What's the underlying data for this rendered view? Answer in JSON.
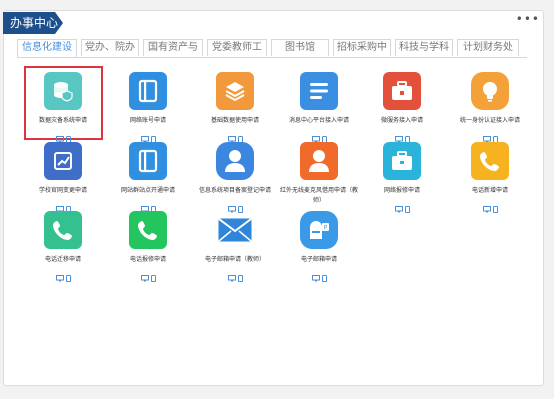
{
  "header": {
    "title": "办事中心",
    "more": "•••"
  },
  "tabs": [
    {
      "label": "信息化建设",
      "active": true
    },
    {
      "label": "党办、院办",
      "active": false
    },
    {
      "label": "国有资产与",
      "active": false
    },
    {
      "label": "党委教师工",
      "active": false
    },
    {
      "label": "图书馆",
      "active": false
    },
    {
      "label": "招标采购中",
      "active": false
    },
    {
      "label": "科技与学科",
      "active": false
    },
    {
      "label": "计划财务处",
      "active": false
    }
  ],
  "apps": [
    {
      "label": "数据灾备系统申请",
      "icon": "database-shield-icon",
      "color": "#58c7c4",
      "selected": true
    },
    {
      "label": "网络账号申请",
      "icon": "book-icon",
      "color": "#2f8fe0"
    },
    {
      "label": "基础数据使用申请",
      "icon": "layers-icon",
      "color": "#f29a3b"
    },
    {
      "label": "消息中心平台接入申请",
      "icon": "list-icon",
      "color": "#3b8fe2"
    },
    {
      "label": "微服务接入申请",
      "icon": "toolbox-icon",
      "color": "#e3513d"
    },
    {
      "label": "统一身份认证接入申请",
      "icon": "bulb-icon",
      "color": "#f5a13a"
    },
    {
      "label": "学校官网变更申请",
      "icon": "chart-icon",
      "color": "#3e6ec7"
    },
    {
      "label": "网站群站点开通申请",
      "icon": "book-icon",
      "color": "#2f8fe0"
    },
    {
      "label": "信息系统项目备案登记申请",
      "icon": "user-icon",
      "color": "#3b86df"
    },
    {
      "label": "红外无线麦克风借用申请（教师）",
      "icon": "user-icon",
      "color": "#f06a2a"
    },
    {
      "label": "网络报修申请",
      "icon": "briefcase-icon",
      "color": "#2ab4dc"
    },
    {
      "label": "电话新增申请",
      "icon": "phone-icon",
      "color": "#f6b31f"
    },
    {
      "label": "电话迁移申请",
      "icon": "phone-icon",
      "color": "#35c18f"
    },
    {
      "label": "电话报修申请",
      "icon": "phone-icon",
      "color": "#22c55e"
    },
    {
      "label": "电子邮箱申请（教师）",
      "icon": "mail-icon",
      "color": "#2f86d8"
    },
    {
      "label": "电子邮箱申请",
      "icon": "mailbox-icon",
      "color": "#3a9ae8"
    }
  ]
}
